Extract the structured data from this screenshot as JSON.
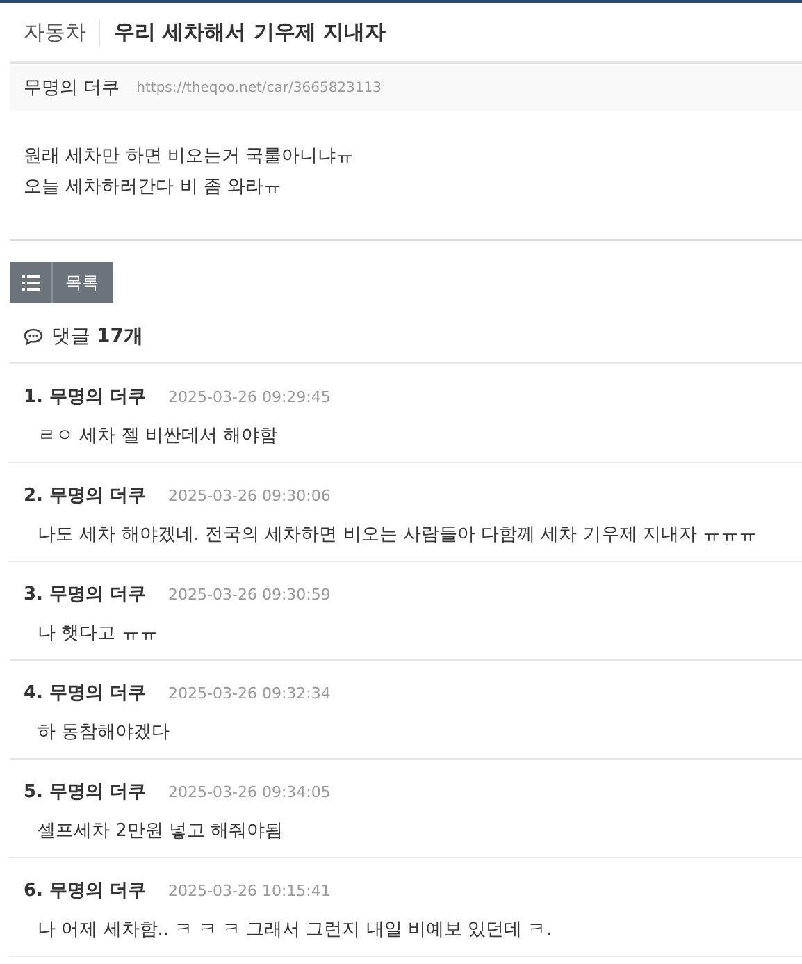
{
  "post": {
    "category": "자동차",
    "title": "우리 세차해서 기우제 지내자",
    "author": "무명의 더쿠",
    "url": "https://theqoo.net/car/3665823113",
    "body": [
      "원래 세차만 하면 비오는거 국룰아니냐ㅠ",
      "오늘 세차하러간다 비 좀 와라ㅠ"
    ]
  },
  "list_button": {
    "label": "목록"
  },
  "comments_header": {
    "label": "댓글",
    "count": "17개"
  },
  "comments": [
    {
      "number": "1.",
      "author": "무명의 더쿠",
      "time": "2025-03-26 09:29:45",
      "text": "ㄹㅇ 세차 젤 비싼데서 해야함"
    },
    {
      "number": "2.",
      "author": "무명의 더쿠",
      "time": "2025-03-26 09:30:06",
      "text": "나도 세차 해야겠네. 전국의 세차하면 비오는 사람들아 다함께 세차 기우제 지내자 ㅠㅠㅠ"
    },
    {
      "number": "3.",
      "author": "무명의 더쿠",
      "time": "2025-03-26 09:30:59",
      "text": "나 햇다고 ㅠㅠ"
    },
    {
      "number": "4.",
      "author": "무명의 더쿠",
      "time": "2025-03-26 09:32:34",
      "text": "하 동참해야겠다"
    },
    {
      "number": "5.",
      "author": "무명의 더쿠",
      "time": "2025-03-26 09:34:05",
      "text": "셀프세차 2만원 넣고 해줘야됨"
    },
    {
      "number": "6.",
      "author": "무명의 더쿠",
      "time": "2025-03-26 10:15:41",
      "text": "나 어제 세차함.. ㅋ ㅋ ㅋ 그래서 그런지 내일 비예보 있던데 ㅋ."
    }
  ]
}
